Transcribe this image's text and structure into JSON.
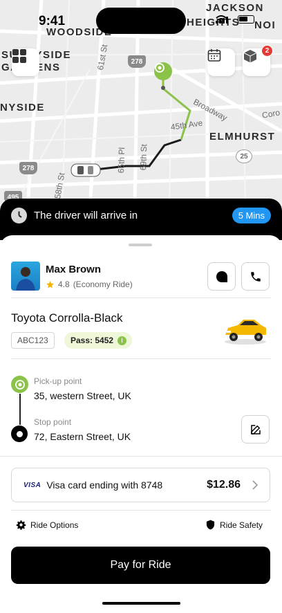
{
  "status_bar": {
    "time": "9:41"
  },
  "map": {
    "neighborhoods": [
      "JACKSON",
      "HEIGHTS",
      "NOI",
      "WOODSIDE",
      "SUNNYSIDE",
      "GARDENS",
      "NYSIDE",
      "ELMHURST"
    ],
    "streets": [
      "61st St",
      "Broadway",
      "45th Ave",
      "65th Pl",
      "69th St",
      "58th St",
      "Coro"
    ],
    "highway_shields": [
      "278",
      "278",
      "25",
      "495"
    ],
    "notification_count": "2",
    "buttons": {
      "menu": "grid-icon",
      "calendar": "calendar-icon",
      "package": "package-icon"
    }
  },
  "arrival": {
    "text": "The driver will arrive in",
    "eta": "5 Mins"
  },
  "driver": {
    "name": "Max Brown",
    "rating": "4.8",
    "ride_type": "(Economy Ride)"
  },
  "vehicle": {
    "model": "Toyota Corrolla-Black",
    "plate": "ABC123",
    "pass": "Pass: 5452",
    "pass_info": "i"
  },
  "route": {
    "pickup_label": "Pick-up point",
    "pickup_address": "35, western Street, UK",
    "stop_label": "Stop point",
    "stop_address": "72, Eastern Street, UK"
  },
  "payment": {
    "card_brand": "VISA",
    "card_text": "Visa card ending with 8748",
    "amount": "$12.86"
  },
  "options": {
    "ride_options": "Ride Options",
    "ride_safety": "Ride Safety"
  },
  "cta": {
    "label": "Pay for Ride"
  },
  "colors": {
    "accent_green": "#8bc34a",
    "eta_blue": "#2196f3",
    "dark": "#000000"
  }
}
